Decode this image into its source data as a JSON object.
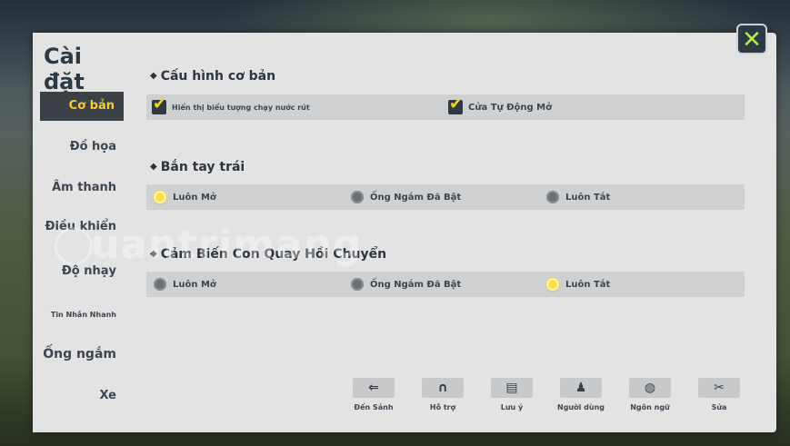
{
  "window": {
    "title": "Cài đặt",
    "close_icon": "close-icon"
  },
  "sidebar": {
    "items": [
      {
        "label": "Cơ bản",
        "active": true
      },
      {
        "label": "Đồ họa"
      },
      {
        "label": "Âm thanh"
      },
      {
        "label": "Điều khiển"
      },
      {
        "label": "Độ nhạy"
      },
      {
        "label": "Tin Nhắn Nhanh"
      },
      {
        "label": "Ống ngắm"
      },
      {
        "label": "Xe"
      }
    ]
  },
  "sections": {
    "basic": {
      "title": "Cấu hình cơ bản",
      "options": [
        {
          "label": "Hiển thị biểu tượng chạy nước rút",
          "checked": true
        },
        {
          "label": "Cửa Tự Động Mở",
          "checked": true
        }
      ]
    },
    "left_fire": {
      "title": "Bắn tay trái",
      "options": [
        {
          "label": "Luôn Mở",
          "selected": true
        },
        {
          "label": "Ống Ngắm Đã Bật",
          "selected": false
        },
        {
          "label": "Luôn Tắt",
          "selected": false
        }
      ]
    },
    "gyro": {
      "title": "Cảm Biến Con Quay Hồi Chuyển",
      "options": [
        {
          "label": "Luôn Mở",
          "selected": false
        },
        {
          "label": "Ống Ngắm Đã Bật",
          "selected": false
        },
        {
          "label": "Luôn Tắt",
          "selected": true
        }
      ]
    }
  },
  "toolbar": {
    "buttons": [
      {
        "label": "Đến Sảnh",
        "icon": "back-arrow-icon"
      },
      {
        "label": "Hỗ trợ",
        "icon": "headset-icon"
      },
      {
        "label": "Lưu ý",
        "icon": "note-icon"
      },
      {
        "label": "Người dùng",
        "icon": "user-icon"
      },
      {
        "label": "Ngôn ngữ",
        "icon": "globe-icon"
      },
      {
        "label": "Sửa",
        "icon": "wrench-icon"
      }
    ]
  },
  "watermark": {
    "text": "uantrimang"
  },
  "colors": {
    "accent": "#f2cc2c",
    "panel": "#e3e3e3",
    "row": "#cfd0d1",
    "dark": "#3b4147"
  }
}
